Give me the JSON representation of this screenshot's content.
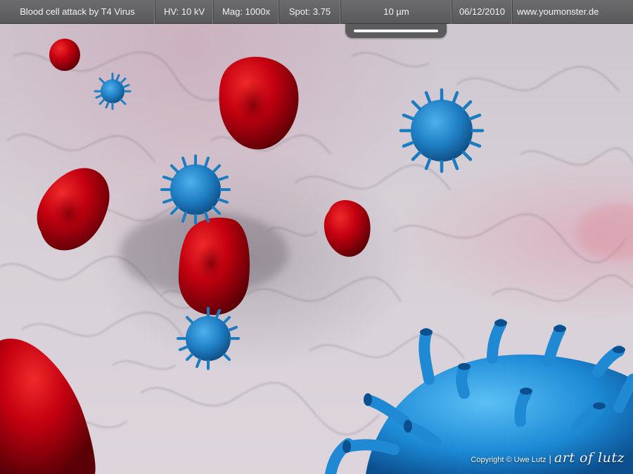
{
  "header": {
    "title": "Blood cell attack by T4 Virus",
    "hv": "HV: 10 kV",
    "mag": "Mag: 1000x",
    "spot": "Spot: 3.75",
    "scale": "10 µm",
    "date": "06/12/2010",
    "website": "www.youmonster.de"
  },
  "footer": {
    "copyright": "Copyright © Uwe Lutz",
    "separator": "|",
    "logo": "art of lutz"
  },
  "colors": {
    "blood_cell": "#b3000c",
    "virus": "#1f7fc4",
    "bar": "#5e5e60"
  }
}
